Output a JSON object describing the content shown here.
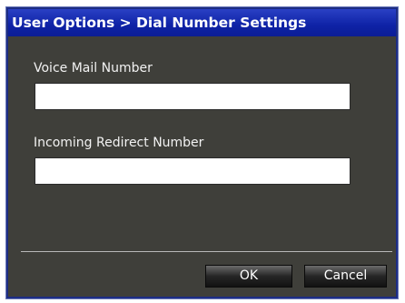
{
  "window": {
    "title": "User Options > Dial Number Settings"
  },
  "fields": {
    "voice_mail": {
      "label": "Voice Mail Number",
      "value": ""
    },
    "incoming_redirect": {
      "label": "Incoming Redirect Number",
      "value": ""
    }
  },
  "buttons": {
    "ok_label": "OK",
    "cancel_label": "Cancel"
  },
  "colors": {
    "title_bar": "#0e22a6",
    "dialog_background": "#3f3f3a",
    "input_background": "#ffffff"
  }
}
